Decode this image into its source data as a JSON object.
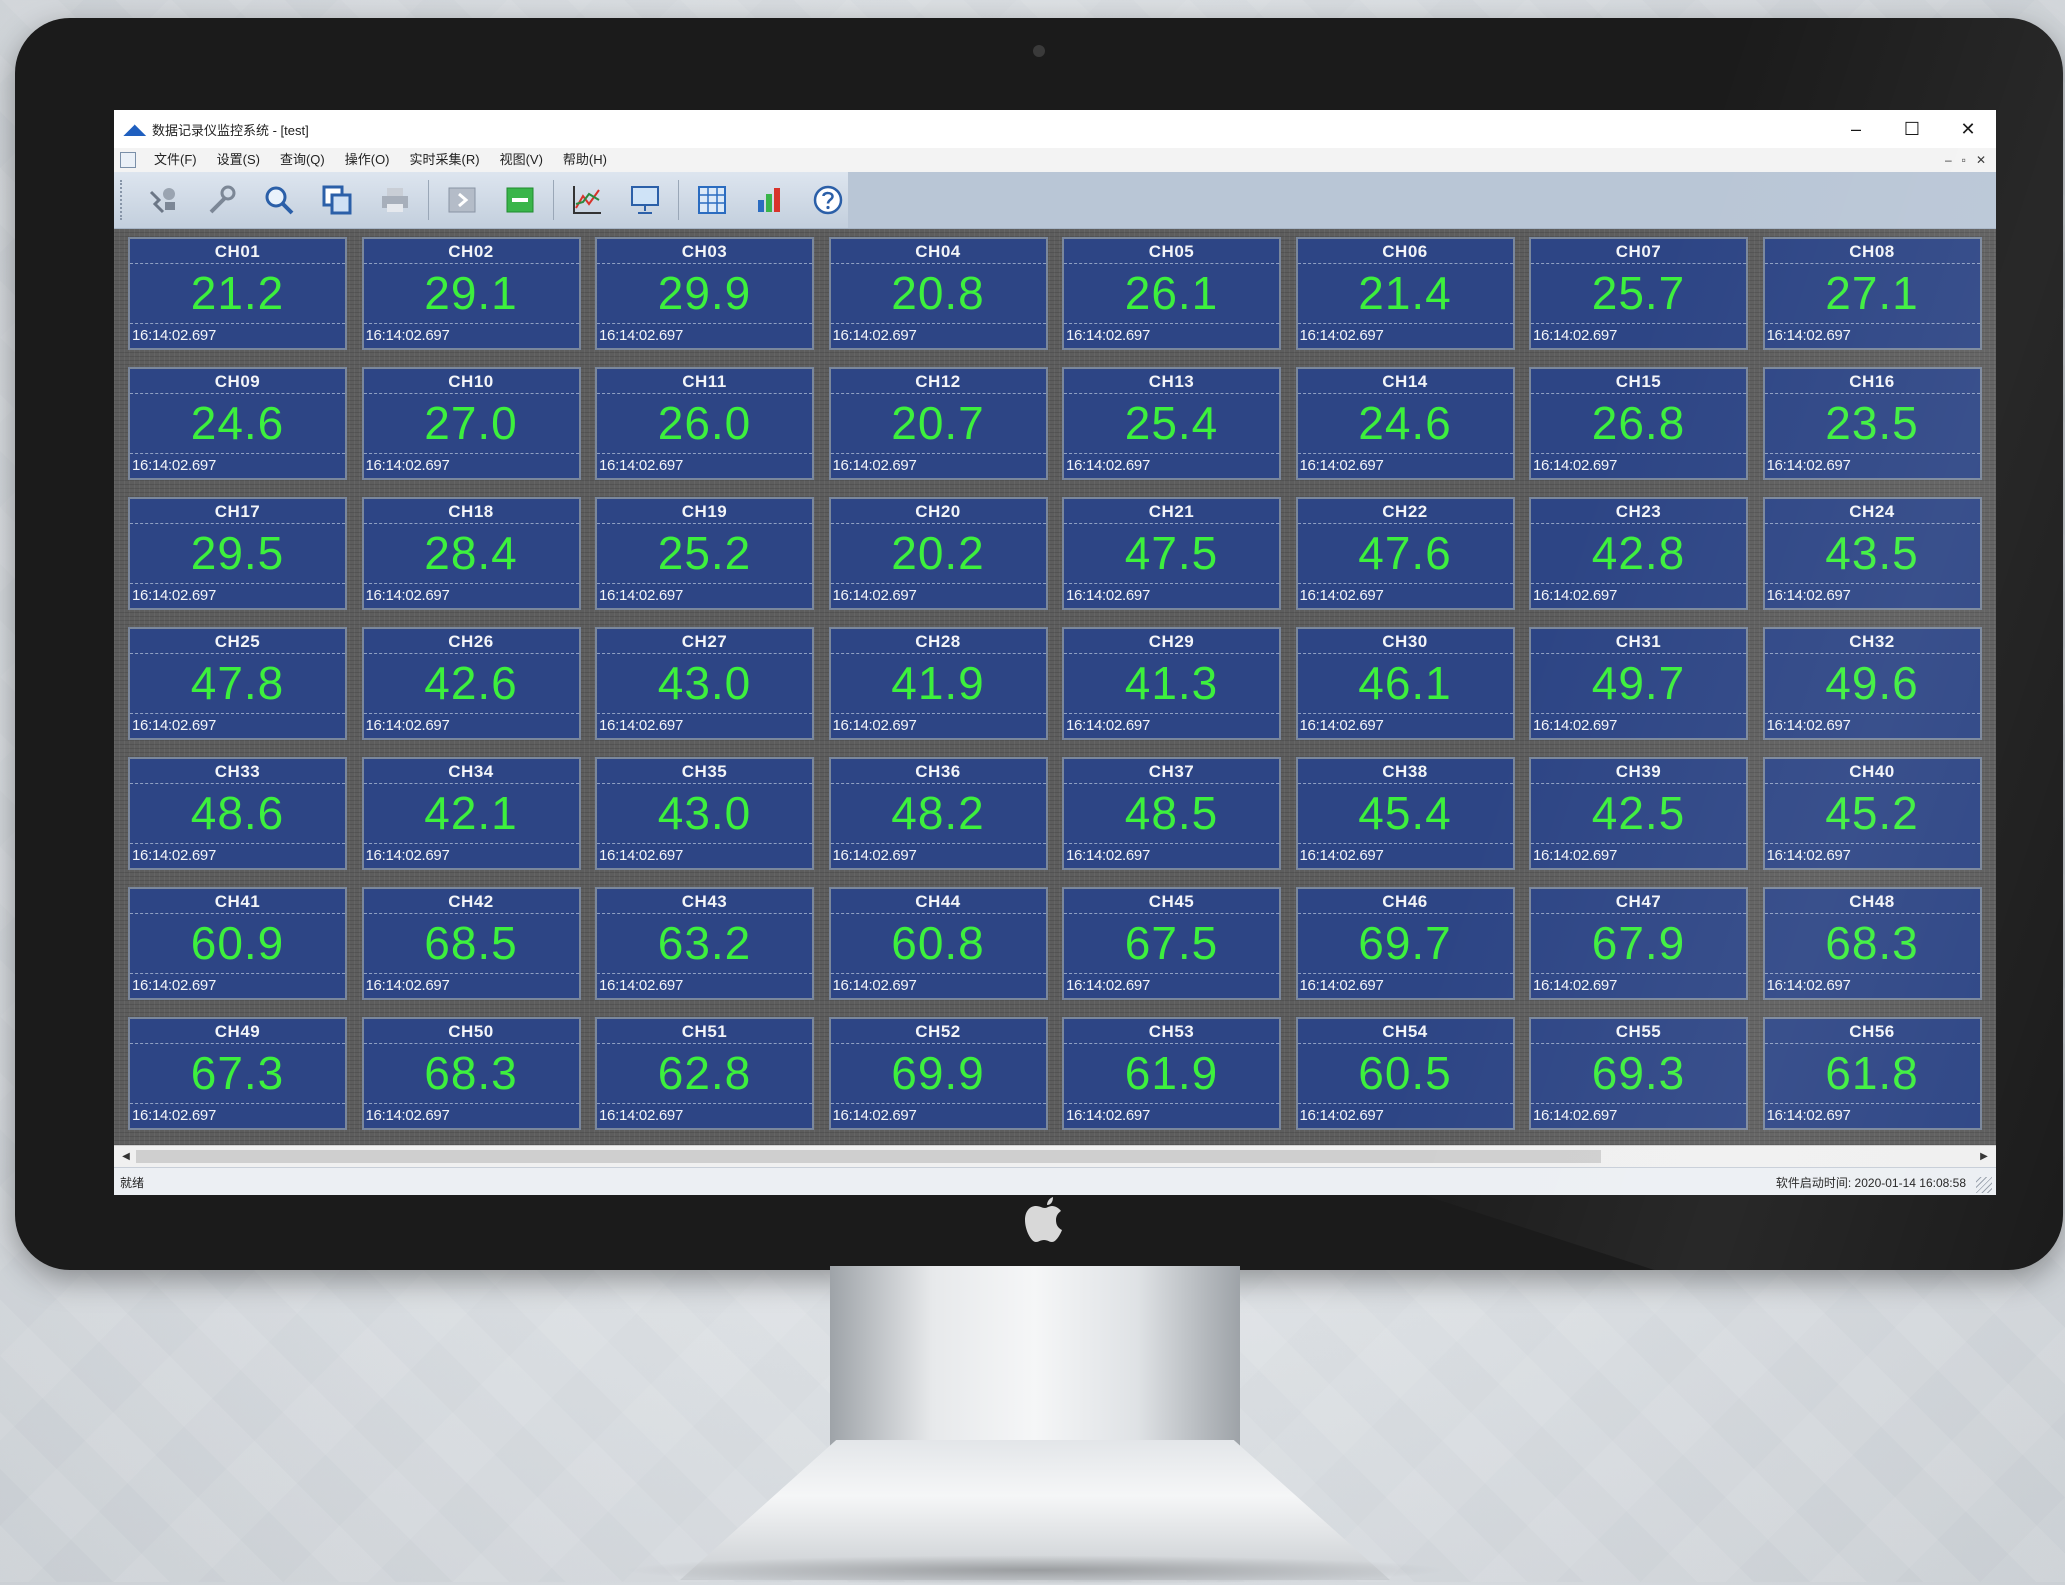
{
  "window": {
    "title": "数据记录仪监控系统 - [test]",
    "minimize": "–",
    "maximize": "☐",
    "close": "✕"
  },
  "menu": [
    {
      "label": "文件(F)"
    },
    {
      "label": "设置(S)"
    },
    {
      "label": "查询(Q)"
    },
    {
      "label": "操作(O)"
    },
    {
      "label": "实时采集(R)"
    },
    {
      "label": "视图(V)"
    },
    {
      "label": "帮助(H)"
    }
  ],
  "mdi_controls": {
    "minimize": "–",
    "restore": "▫",
    "close": "✕"
  },
  "toolbar": [
    {
      "icon": "connect-icon"
    },
    {
      "icon": "tools-icon"
    },
    {
      "icon": "search-icon"
    },
    {
      "icon": "copy-icon"
    },
    {
      "icon": "print-icon"
    },
    {
      "icon": "play-icon"
    },
    {
      "icon": "stop-icon"
    },
    {
      "icon": "curve-chart-icon"
    },
    {
      "icon": "monitor-icon"
    },
    {
      "icon": "table-icon"
    },
    {
      "icon": "bar-chart-icon"
    },
    {
      "icon": "help-icon"
    }
  ],
  "channels": [
    {
      "name": "CH01",
      "value": "21.2",
      "time": "16:14:02.697"
    },
    {
      "name": "CH02",
      "value": "29.1",
      "time": "16:14:02.697"
    },
    {
      "name": "CH03",
      "value": "29.9",
      "time": "16:14:02.697"
    },
    {
      "name": "CH04",
      "value": "20.8",
      "time": "16:14:02.697"
    },
    {
      "name": "CH05",
      "value": "26.1",
      "time": "16:14:02.697"
    },
    {
      "name": "CH06",
      "value": "21.4",
      "time": "16:14:02.697"
    },
    {
      "name": "CH07",
      "value": "25.7",
      "time": "16:14:02.697"
    },
    {
      "name": "CH08",
      "value": "27.1",
      "time": "16:14:02.697"
    },
    {
      "name": "CH09",
      "value": "24.6",
      "time": "16:14:02.697"
    },
    {
      "name": "CH10",
      "value": "27.0",
      "time": "16:14:02.697"
    },
    {
      "name": "CH11",
      "value": "26.0",
      "time": "16:14:02.697"
    },
    {
      "name": "CH12",
      "value": "20.7",
      "time": "16:14:02.697"
    },
    {
      "name": "CH13",
      "value": "25.4",
      "time": "16:14:02.697"
    },
    {
      "name": "CH14",
      "value": "24.6",
      "time": "16:14:02.697"
    },
    {
      "name": "CH15",
      "value": "26.8",
      "time": "16:14:02.697"
    },
    {
      "name": "CH16",
      "value": "23.5",
      "time": "16:14:02.697"
    },
    {
      "name": "CH17",
      "value": "29.5",
      "time": "16:14:02.697"
    },
    {
      "name": "CH18",
      "value": "28.4",
      "time": "16:14:02.697"
    },
    {
      "name": "CH19",
      "value": "25.2",
      "time": "16:14:02.697"
    },
    {
      "name": "CH20",
      "value": "20.2",
      "time": "16:14:02.697"
    },
    {
      "name": "CH21",
      "value": "47.5",
      "time": "16:14:02.697"
    },
    {
      "name": "CH22",
      "value": "47.6",
      "time": "16:14:02.697"
    },
    {
      "name": "CH23",
      "value": "42.8",
      "time": "16:14:02.697"
    },
    {
      "name": "CH24",
      "value": "43.5",
      "time": "16:14:02.697"
    },
    {
      "name": "CH25",
      "value": "47.8",
      "time": "16:14:02.697"
    },
    {
      "name": "CH26",
      "value": "42.6",
      "time": "16:14:02.697"
    },
    {
      "name": "CH27",
      "value": "43.0",
      "time": "16:14:02.697"
    },
    {
      "name": "CH28",
      "value": "41.9",
      "time": "16:14:02.697"
    },
    {
      "name": "CH29",
      "value": "41.3",
      "time": "16:14:02.697"
    },
    {
      "name": "CH30",
      "value": "46.1",
      "time": "16:14:02.697"
    },
    {
      "name": "CH31",
      "value": "49.7",
      "time": "16:14:02.697"
    },
    {
      "name": "CH32",
      "value": "49.6",
      "time": "16:14:02.697"
    },
    {
      "name": "CH33",
      "value": "48.6",
      "time": "16:14:02.697"
    },
    {
      "name": "CH34",
      "value": "42.1",
      "time": "16:14:02.697"
    },
    {
      "name": "CH35",
      "value": "43.0",
      "time": "16:14:02.697"
    },
    {
      "name": "CH36",
      "value": "48.2",
      "time": "16:14:02.697"
    },
    {
      "name": "CH37",
      "value": "48.5",
      "time": "16:14:02.697"
    },
    {
      "name": "CH38",
      "value": "45.4",
      "time": "16:14:02.697"
    },
    {
      "name": "CH39",
      "value": "42.5",
      "time": "16:14:02.697"
    },
    {
      "name": "CH40",
      "value": "45.2",
      "time": "16:14:02.697"
    },
    {
      "name": "CH41",
      "value": "60.9",
      "time": "16:14:02.697"
    },
    {
      "name": "CH42",
      "value": "68.5",
      "time": "16:14:02.697"
    },
    {
      "name": "CH43",
      "value": "63.2",
      "time": "16:14:02.697"
    },
    {
      "name": "CH44",
      "value": "60.8",
      "time": "16:14:02.697"
    },
    {
      "name": "CH45",
      "value": "67.5",
      "time": "16:14:02.697"
    },
    {
      "name": "CH46",
      "value": "69.7",
      "time": "16:14:02.697"
    },
    {
      "name": "CH47",
      "value": "67.9",
      "time": "16:14:02.697"
    },
    {
      "name": "CH48",
      "value": "68.3",
      "time": "16:14:02.697"
    },
    {
      "name": "CH49",
      "value": "67.3",
      "time": "16:14:02.697"
    },
    {
      "name": "CH50",
      "value": "68.3",
      "time": "16:14:02.697"
    },
    {
      "name": "CH51",
      "value": "62.8",
      "time": "16:14:02.697"
    },
    {
      "name": "CH52",
      "value": "69.9",
      "time": "16:14:02.697"
    },
    {
      "name": "CH53",
      "value": "61.9",
      "time": "16:14:02.697"
    },
    {
      "name": "CH54",
      "value": "60.5",
      "time": "16:14:02.697"
    },
    {
      "name": "CH55",
      "value": "69.3",
      "time": "16:14:02.697"
    },
    {
      "name": "CH56",
      "value": "61.8",
      "time": "16:14:02.697"
    }
  ],
  "statusbar": {
    "left": "就绪",
    "right": "软件启动时间: 2020-01-14 16:08:58"
  },
  "scrollbar": {
    "left_arrow": "◀",
    "right_arrow": "▶"
  },
  "colors": {
    "tile_bg": "#2d4585",
    "value_green": "#3df03d",
    "grid_bg": "#5d5d5d",
    "toolbar_bg": "#c3cfdd"
  }
}
